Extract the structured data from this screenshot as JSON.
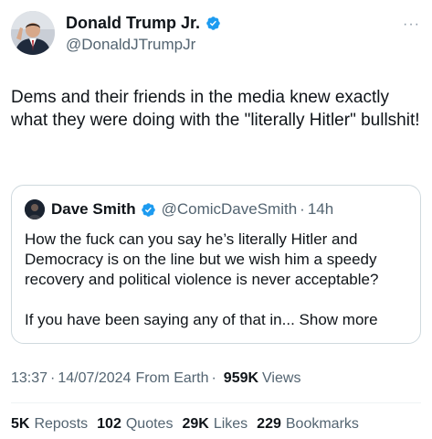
{
  "author": {
    "name": "Donald Trump Jr.",
    "handle": "@DonaldJTrumpJr",
    "verified_color": "#1d9bf0"
  },
  "tweet": {
    "text": "Dems and their friends in the media knew exactly what they were doing with the \"literally Hitler\" bullshit!"
  },
  "quoted": {
    "name": "Dave Smith",
    "handle": "@ComicDaveSmith",
    "separator": "·",
    "time": "14h",
    "paragraph1": "How the fuck can you say he’s literally Hitler and Democracy is on the line but we wish him a speedy recovery and political violence is never acceptable?",
    "paragraph2": "If you have been saying any of that in...",
    "show_more": "Show more"
  },
  "meta": {
    "time": "13:37",
    "separator": "·",
    "date": "14/07/2024",
    "source": "From Earth",
    "views_count": "959K",
    "views_label": "Views"
  },
  "stats": [
    {
      "count": "5K",
      "label": "Reposts"
    },
    {
      "count": "102",
      "label": "Quotes"
    },
    {
      "count": "29K",
      "label": "Likes"
    },
    {
      "count": "229",
      "label": "Bookmarks"
    }
  ],
  "more_icon": "···",
  "icons": {
    "verified": "verified-badge-icon",
    "more": "more-options-icon"
  }
}
